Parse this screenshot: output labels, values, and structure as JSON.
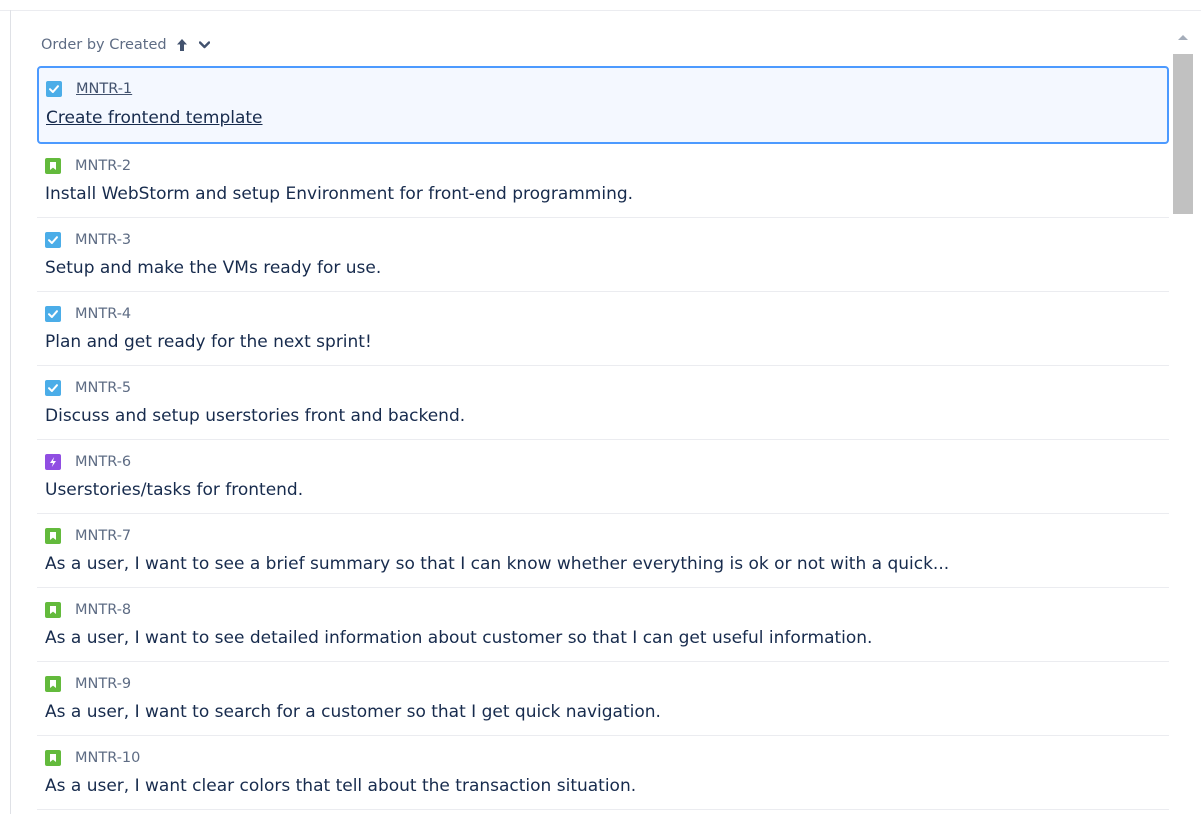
{
  "order_bar": {
    "label": "Order by Created",
    "direction_icon": "arrow-up-icon",
    "menu_icon": "chevron-down-icon"
  },
  "colors": {
    "task": "#4bade8",
    "story": "#63ba3c",
    "epic": "#904ee2",
    "selected_border": "#4c9aff"
  },
  "issues": [
    {
      "key": "MNTR-1",
      "type": "task",
      "summary": "Create frontend template"
    },
    {
      "key": "MNTR-2",
      "type": "story",
      "summary": "Install WebStorm and setup Environment for front-end programming."
    },
    {
      "key": "MNTR-3",
      "type": "task",
      "summary": "Setup and make the VMs ready for use."
    },
    {
      "key": "MNTR-4",
      "type": "task",
      "summary": "Plan and get ready for the next sprint!"
    },
    {
      "key": "MNTR-5",
      "type": "task",
      "summary": "Discuss and setup userstories front and backend."
    },
    {
      "key": "MNTR-6",
      "type": "epic",
      "summary": "Userstories/tasks for frontend."
    },
    {
      "key": "MNTR-7",
      "type": "story",
      "summary": "As a user, I want to see a brief summary so that I can know whether everything is ok or not with a quick..."
    },
    {
      "key": "MNTR-8",
      "type": "story",
      "summary": "As a user, I want to see detailed information about customer so that I can get useful information."
    },
    {
      "key": "MNTR-9",
      "type": "story",
      "summary": "As a user, I want to search for a customer so that I get quick navigation."
    },
    {
      "key": "MNTR-10",
      "type": "story",
      "summary": "As a user, I want clear colors that tell about the transaction situation."
    }
  ]
}
